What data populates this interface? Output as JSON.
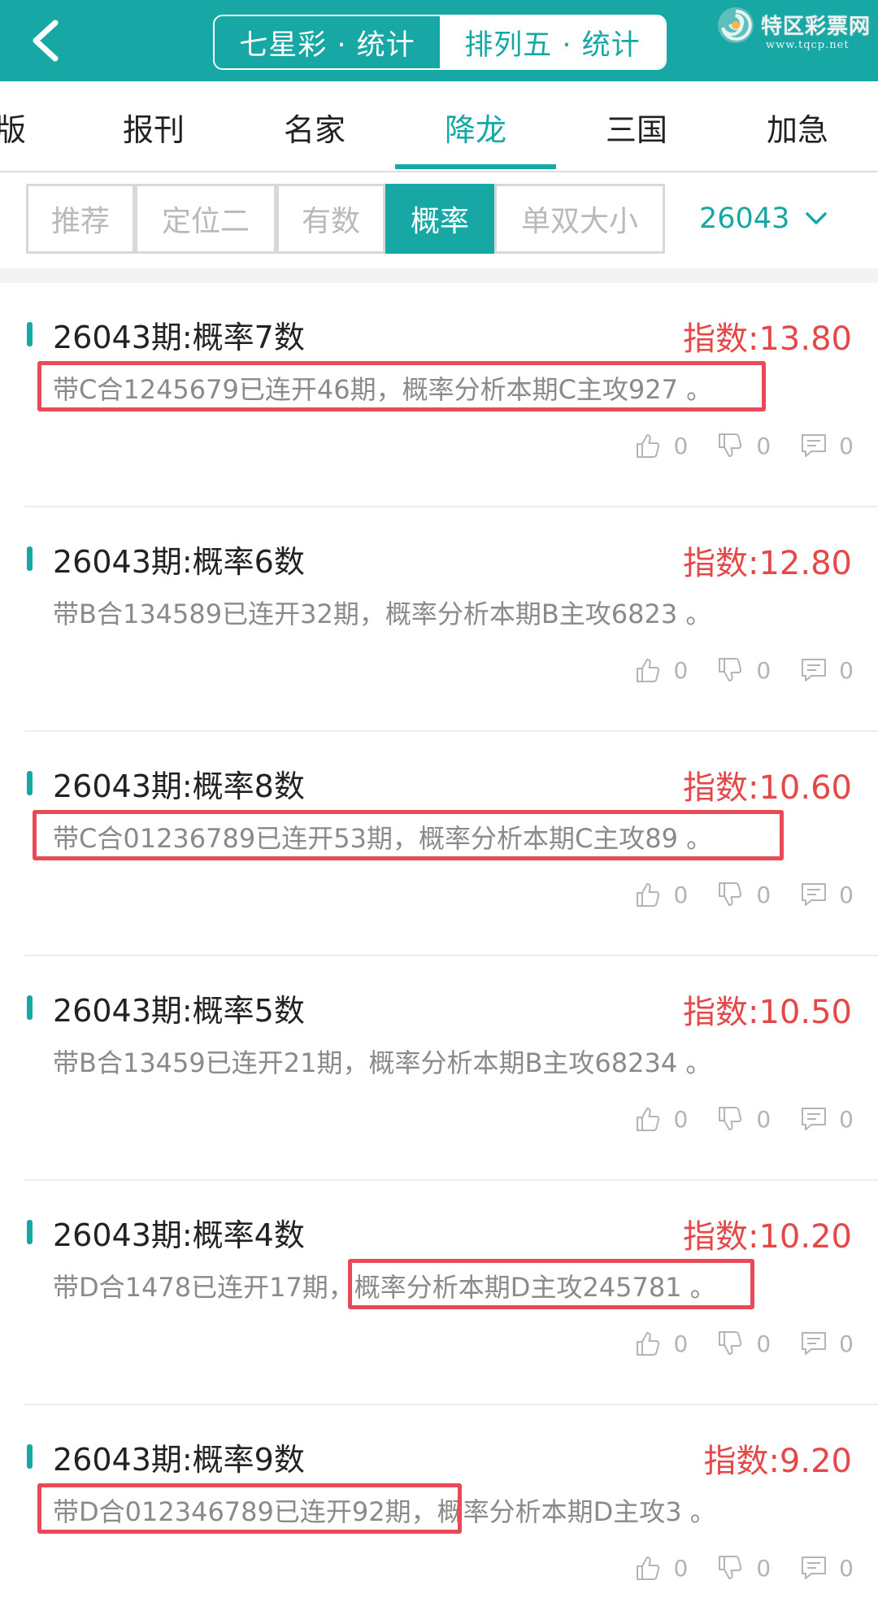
{
  "header": {
    "segments": [
      {
        "label": "七星彩 · 统计",
        "active": true
      },
      {
        "label": "排列五 · 统计",
        "active": false
      }
    ],
    "watermark": {
      "name": "特区彩票网",
      "url": "www.tqcp.net"
    }
  },
  "category_tabs": [
    {
      "label": "版"
    },
    {
      "label": "报刊"
    },
    {
      "label": "名家"
    },
    {
      "label": "降龙",
      "active": true
    },
    {
      "label": "三国"
    },
    {
      "label": "加急"
    }
  ],
  "filters": [
    {
      "label": "推荐"
    },
    {
      "label": "定位二"
    },
    {
      "label": "有数"
    },
    {
      "label": "概率",
      "active": true
    },
    {
      "label": "单双大小"
    }
  ],
  "issue_selector": {
    "value": "26043"
  },
  "items": [
    {
      "title": "26043期:概率7数",
      "index": "指数:13.80",
      "desc": "带C合1245679已连开46期，概率分析本期C主攻927 。",
      "likes": "0",
      "dislikes": "0",
      "comments": "0"
    },
    {
      "title": "26043期:概率6数",
      "index": "指数:12.80",
      "desc": "带B合134589已连开32期，概率分析本期B主攻6823 。",
      "likes": "0",
      "dislikes": "0",
      "comments": "0"
    },
    {
      "title": "26043期:概率8数",
      "index": "指数:10.60",
      "desc": "带C合01236789已连开53期，概率分析本期C主攻89 。",
      "likes": "0",
      "dislikes": "0",
      "comments": "0"
    },
    {
      "title": "26043期:概率5数",
      "index": "指数:10.50",
      "desc": "带B合13459已连开21期，概率分析本期B主攻68234 。",
      "likes": "0",
      "dislikes": "0",
      "comments": "0"
    },
    {
      "title": "26043期:概率4数",
      "index": "指数:10.20",
      "desc": "带D合1478已连开17期，概率分析本期D主攻245781 。",
      "likes": "0",
      "dislikes": "0",
      "comments": "0"
    },
    {
      "title": "26043期:概率9数",
      "index": "指数:9.20",
      "desc": "带D合012346789已连开92期，概率分析本期D主攻3 。",
      "likes": "0",
      "dislikes": "0",
      "comments": "0"
    }
  ],
  "colors": {
    "accent": "#17a8a6",
    "index_red": "#e44848",
    "highlight_box": "#ea4a57"
  }
}
